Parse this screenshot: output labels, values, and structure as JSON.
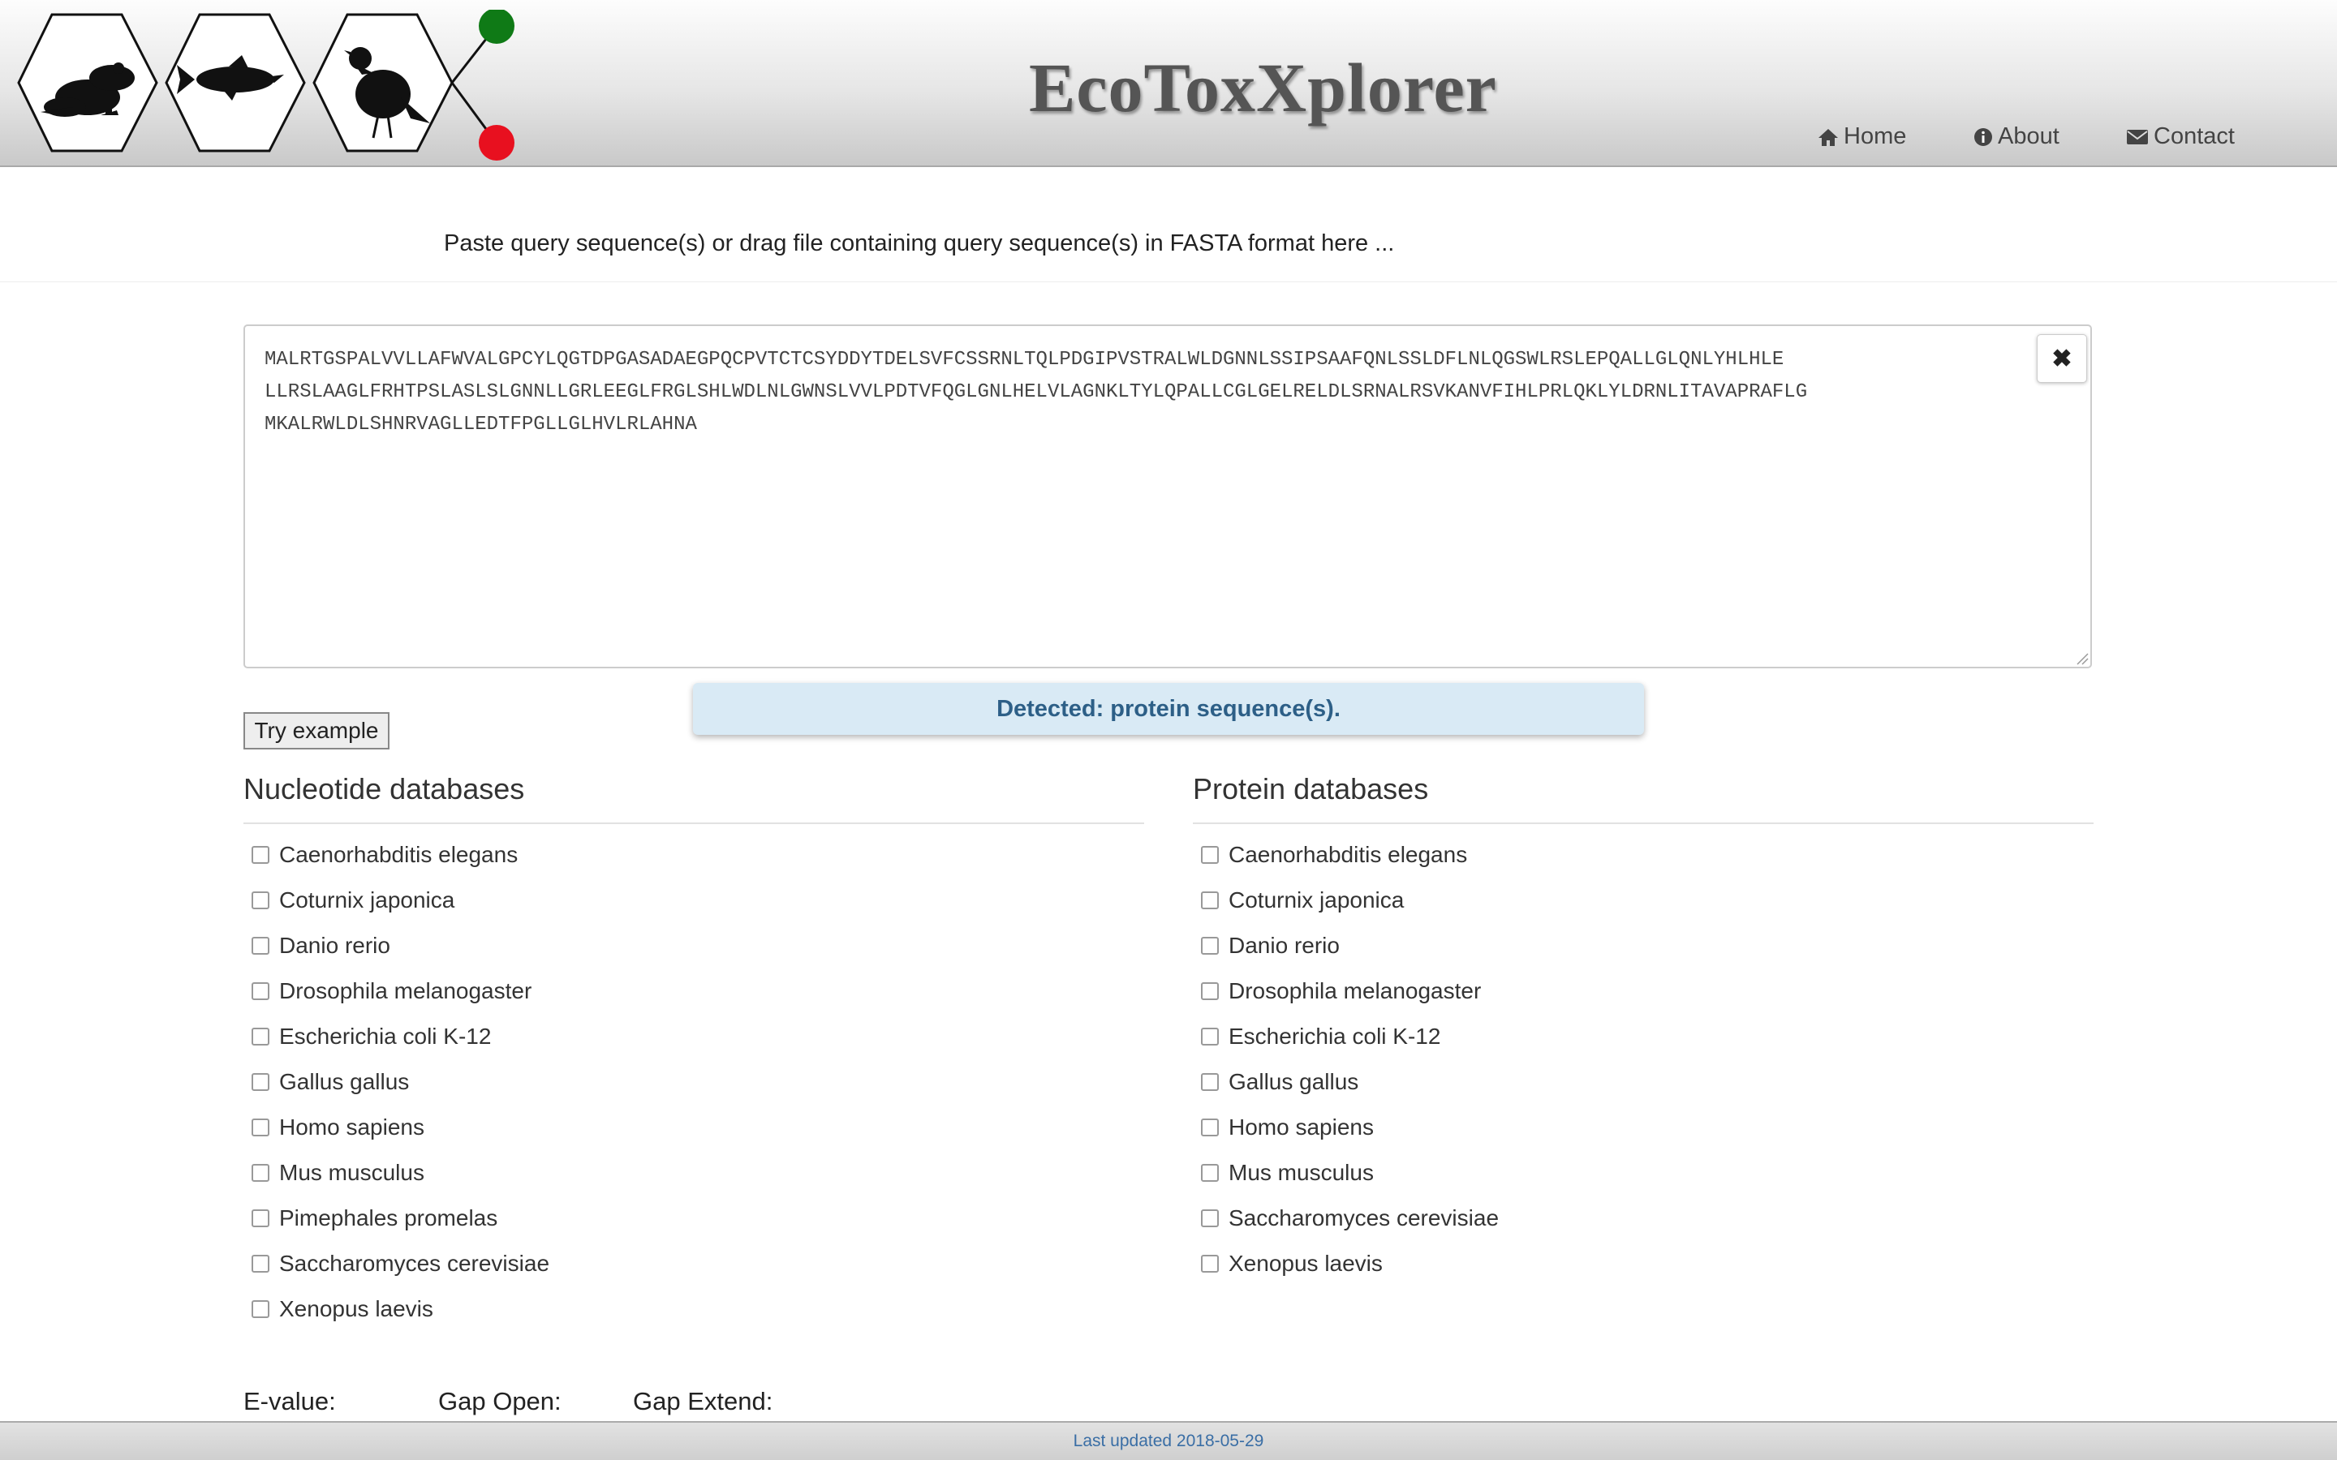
{
  "header": {
    "title": "EcoToxXplorer",
    "nav": {
      "home": "Home",
      "about": "About",
      "contact": "Contact"
    }
  },
  "query": {
    "instruction": "Paste query sequence(s) or drag file containing query sequence(s) in FASTA format here ...",
    "sequence_lines": [
      "MALRTGSPALVVLLAFWVALGPCYLQGTDPGASADAEGPQCPVTCTCSYDDYTDELSVFCSSRNLTQLPDGIPVSTRALWLDGNNLSSIPSAAFQNLSSLDFLNLQGSWLRSLEPQALLGLQNLYHLHLE",
      "LLRSLAAGLFRHTPSLASLSLGNNLLGRLEEGLFRGLSHLWDLNLGWNSLVVLPDTVFQGLGNLHELVLAGNKLTYLQPALLCGLGELRELDLSRNALRSVKANVFIHLPRLQKLYLDRNLITAVAPRAFLG",
      "MKALRWLDLSHNRVAGLLEDTFPGLLGLHVLRLAHNA"
    ],
    "clear_icon": "close-icon",
    "try_example": "Try example",
    "detected": "Detected: protein sequence(s)."
  },
  "databases": {
    "nucleotide": {
      "heading": "Nucleotide databases",
      "items": [
        "Caenorhabditis elegans",
        "Coturnix japonica",
        "Danio rerio",
        "Drosophila melanogaster",
        "Escherichia coli K-12",
        "Gallus gallus",
        "Homo sapiens",
        "Mus musculus",
        "Pimephales promelas",
        "Saccharomyces cerevisiae",
        "Xenopus laevis"
      ]
    },
    "protein": {
      "heading": "Protein databases",
      "items": [
        "Caenorhabditis elegans",
        "Coturnix japonica",
        "Danio rerio",
        "Drosophila melanogaster",
        "Escherichia coli K-12",
        "Gallus gallus",
        "Homo sapiens",
        "Mus musculus",
        "Saccharomyces cerevisiae",
        "Xenopus laevis"
      ]
    }
  },
  "params": {
    "evalue": "E-value:",
    "gap_open": "Gap Open:",
    "gap_extend": "Gap Extend:"
  },
  "footer": {
    "updated": "Last updated 2018-05-29"
  },
  "colors": {
    "green_node": "#0f7a16",
    "red_node": "#e8101f",
    "detected_bg": "#d9eaf5",
    "detected_text": "#2d5f87"
  }
}
